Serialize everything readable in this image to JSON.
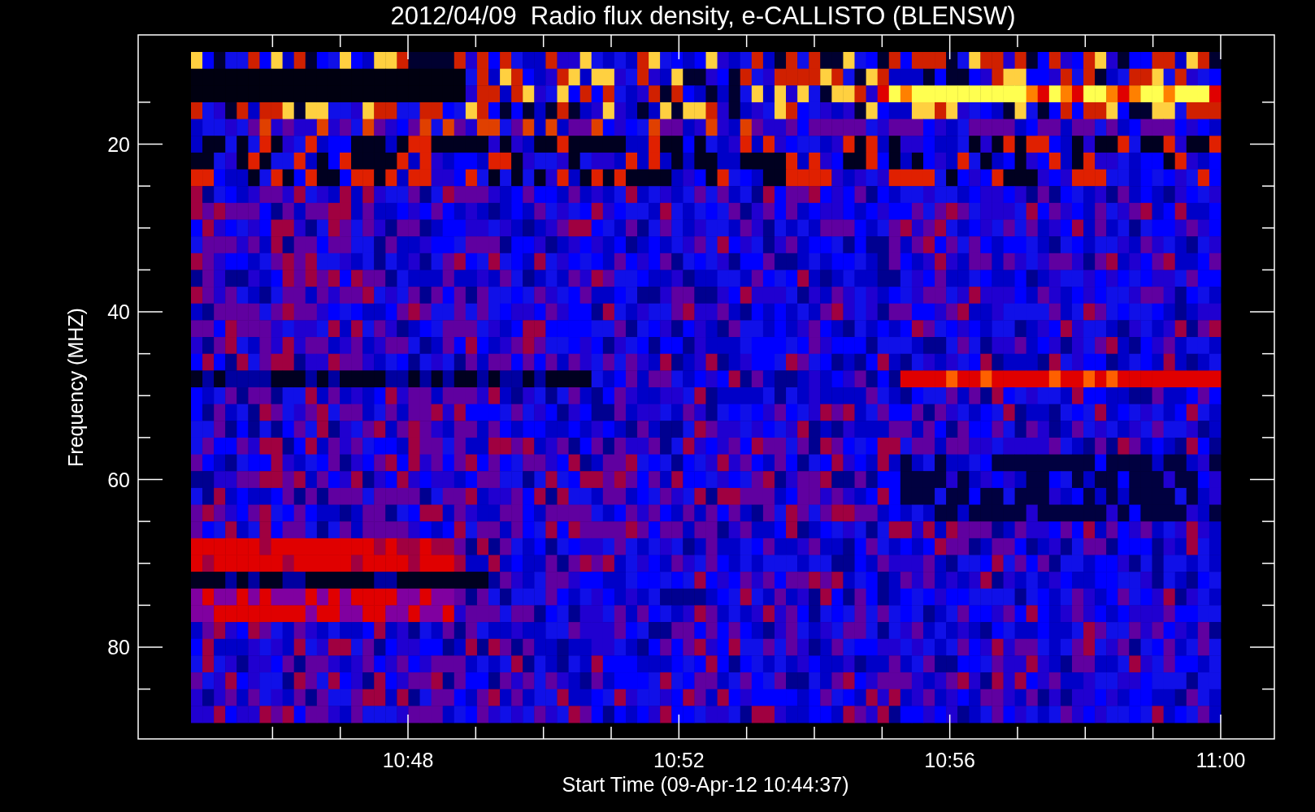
{
  "title": "2012/04/09  Radio flux density, e-CALLISTO (BLENSW)",
  "y_axis": {
    "label": "Frequency (MHZ)",
    "ticks": [
      "20",
      "40",
      "60",
      "80"
    ]
  },
  "x_axis": {
    "label": "Start Time (09-Apr-12 10:44:37)",
    "ticks": [
      "10:48",
      "10:52",
      "10:56",
      "11:00"
    ]
  }
}
